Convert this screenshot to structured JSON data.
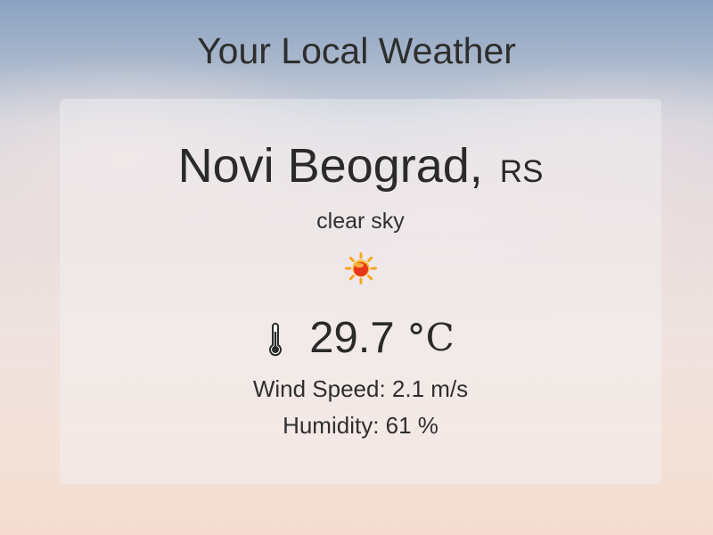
{
  "header": {
    "title": "Your Local Weather"
  },
  "weather": {
    "city": "Novi Beograd,",
    "country": "RS",
    "description": "clear sky",
    "icon": "sun-icon",
    "temperature": "29.7",
    "unit": "°C",
    "wind_label": "Wind Speed:",
    "wind_value": "2.1 m/s",
    "humidity_label": "Humidity:",
    "humidity_value": "61 %"
  },
  "colors": {
    "text": "#333333",
    "sun": "#e8361c",
    "sun_rays": "#f6a623"
  }
}
